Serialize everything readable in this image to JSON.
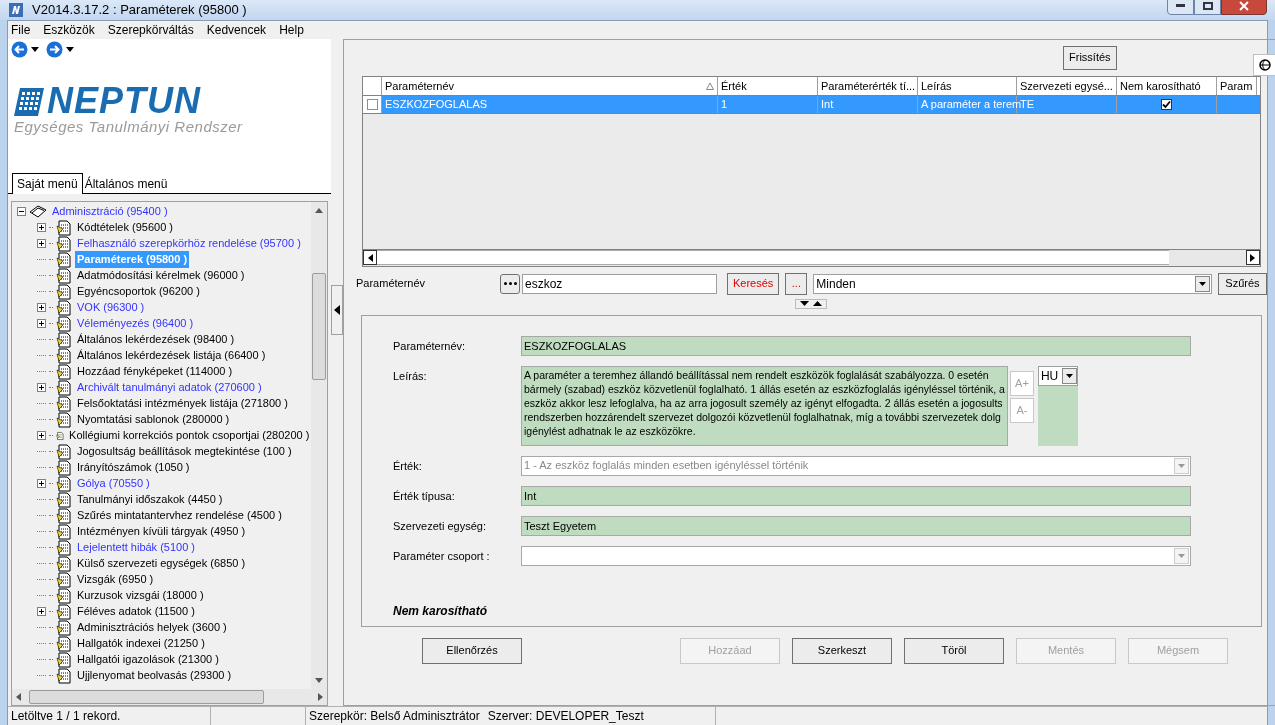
{
  "window": {
    "title": "V2014.3.17.2 : Paraméterek (95800  )"
  },
  "menu": [
    "File",
    "Eszközök",
    "Szerepkörváltás",
    "Kedvencek",
    "Help"
  ],
  "logo": {
    "name": "NEPTUN",
    "subtitle": "Egységes Tanulmányi Rendszer"
  },
  "menu_tabs": [
    {
      "label": "Saját menü",
      "selected": true
    },
    {
      "label": "Általános menü",
      "selected": false
    }
  ],
  "tree": [
    {
      "label": "Adminisztráció (95400  )",
      "kind": "link",
      "selected": false,
      "expanded": true,
      "children": [
        {
          "label": "Kódtételek (95600  )",
          "kind": "plain",
          "selected": false,
          "expandable": true
        },
        {
          "label": "Felhasználó szerepkörhöz rendelése (95700  )",
          "kind": "link",
          "selected": false,
          "expandable": true
        },
        {
          "label": "Paraméterek (95800  )",
          "kind": "plain",
          "selected": true,
          "expandable": false
        },
        {
          "label": "Adatmódosítási kérelmek (96000  )",
          "kind": "plain",
          "selected": false,
          "expandable": false
        },
        {
          "label": "Egyéncsoportok (96200  )",
          "kind": "plain",
          "selected": false,
          "expandable": false
        },
        {
          "label": "VOK (96300  )",
          "kind": "link",
          "selected": false,
          "expandable": true
        },
        {
          "label": "Véleményezés (96400  )",
          "kind": "link",
          "selected": false,
          "expandable": true
        },
        {
          "label": "Általános lekérdezések (98400  )",
          "kind": "plain",
          "selected": false,
          "expandable": false
        },
        {
          "label": "Általános lekérdezések listája  (66400  )",
          "kind": "plain",
          "selected": false,
          "expandable": false
        },
        {
          "label": "Hozzáad fényképeket (114000  )",
          "kind": "plain",
          "selected": false,
          "expandable": false
        },
        {
          "label": "Archivált tanulmányi adatok (270600  )",
          "kind": "link",
          "selected": false,
          "expandable": true
        },
        {
          "label": "Felsőoktatási intézmények listája (271800  )",
          "kind": "plain",
          "selected": false,
          "expandable": false
        },
        {
          "label": "Nyomtatási sablonok (280000  )",
          "kind": "plain",
          "selected": false,
          "expandable": false
        },
        {
          "label": "Kollégiumi korrekciós pontok csoportjai (280200  )",
          "kind": "plain",
          "selected": false,
          "expandable": true
        },
        {
          "label": "Jogosultság beállítások megtekintése (100  )",
          "kind": "plain",
          "selected": false,
          "expandable": false
        },
        {
          "label": "Irányítószámok (1050  )",
          "kind": "plain",
          "selected": false,
          "expandable": false
        },
        {
          "label": "Gólya (70550  )",
          "kind": "link",
          "selected": false,
          "expandable": true
        },
        {
          "label": "Tanulmányi időszakok (4450  )",
          "kind": "plain",
          "selected": false,
          "expandable": false
        },
        {
          "label": "Szűrés mintatantervhez rendelése (4500  )",
          "kind": "plain",
          "selected": false,
          "expandable": false
        },
        {
          "label": "Intézményen kívüli tárgyak (4950  )",
          "kind": "plain",
          "selected": false,
          "expandable": false
        },
        {
          "label": "Lejelentett hibák (5100  )",
          "kind": "link",
          "selected": false,
          "expandable": false
        },
        {
          "label": "Külső szervezeti egységek (6850  )",
          "kind": "plain",
          "selected": false,
          "expandable": false
        },
        {
          "label": "Vizsgák (6950  )",
          "kind": "plain",
          "selected": false,
          "expandable": false
        },
        {
          "label": "Kurzusok vizsgái (18000  )",
          "kind": "plain",
          "selected": false,
          "expandable": false
        },
        {
          "label": "Féléves adatok (11500  )",
          "kind": "plain",
          "selected": false,
          "expandable": true
        },
        {
          "label": "Adminisztrációs helyek (3600  )",
          "kind": "plain",
          "selected": false,
          "expandable": false
        },
        {
          "label": "Hallgatók indexei (21250  )",
          "kind": "plain",
          "selected": false,
          "expandable": false
        },
        {
          "label": "Hallgatói igazolások (21300  )",
          "kind": "plain",
          "selected": false,
          "expandable": false
        },
        {
          "label": "Ujjlenyomat beolvasás (29300  )",
          "kind": "plain",
          "selected": false,
          "expandable": false
        }
      ]
    }
  ],
  "grid": {
    "refresh_button": "Frissítés",
    "columns": [
      "Paraméternév",
      "Érték",
      "Paraméterérték tí...",
      "Leírás",
      "Szervezeti egysé...",
      "Nem karosítható",
      "Param"
    ],
    "rows": [
      {
        "selected": true,
        "checked": false,
        "cells": [
          "ESZKOZFOGLALAS",
          "1",
          "Int",
          "A paraméter a terem",
          "TE"
        ],
        "nem_karosithato": true
      }
    ]
  },
  "filter": {
    "label": "Paraméternév",
    "value": "eszkoz",
    "search_button": "Keresés",
    "more_button": "...",
    "scope": "Minden",
    "filter_button": "Szűrés"
  },
  "details": {
    "fields": [
      {
        "kind": "text",
        "label": "Paraméternév:",
        "value": "ESZKOZFOGLALAS"
      },
      {
        "kind": "memo",
        "label": "Leírás:",
        "lines": [
          "A paraméter a teremhez állandó beállítással nem rendelt eszközök foglalását szabályozza. 0 esetén",
          "bármely (szabad) eszköz közvetlenül foglalható. 1 állás esetén az eszközfoglalás igényléssel történik, a",
          "eszköz akkor lesz lefoglalva, ha az arra jogosult személy az igényt elfogadta. 2 állás esetén a jogosults",
          "rendszerben hozzárendelt szervezet dolgozói közvetlenül foglalhatnak, míg a további szervezetek dolg",
          "igénylést adhatnak le az eszközökre."
        ],
        "font_up": "A+",
        "font_down": "A-",
        "language": "HU"
      },
      {
        "kind": "combo",
        "label": "Érték:",
        "value": "1 - Az eszköz foglalás minden esetben igényléssel történik",
        "disabled": true
      },
      {
        "kind": "text",
        "label": "Érték típusa:",
        "value": "Int"
      },
      {
        "kind": "text",
        "label": "Szervezeti egység:",
        "value": "Teszt Egyetem"
      },
      {
        "kind": "combo",
        "label": "Paraméter csoport :"
      }
    ],
    "note": "Nem karosítható"
  },
  "buttons": [
    {
      "label": "Ellenőrzés",
      "disabled": false
    },
    {
      "label": "Hozzáad",
      "disabled": true
    },
    {
      "label": "Szerkeszt",
      "disabled": false
    },
    {
      "label": "Töröl",
      "disabled": false
    },
    {
      "label": "Mentés",
      "disabled": true
    },
    {
      "label": "Mégsem",
      "disabled": true
    }
  ],
  "status_bar": {
    "records": "Letöltve 1 / 1 rekord.",
    "role": "Szerepkör: Belső Adminisztrátor",
    "server": "Szerver: DEVELOPER_Teszt"
  }
}
